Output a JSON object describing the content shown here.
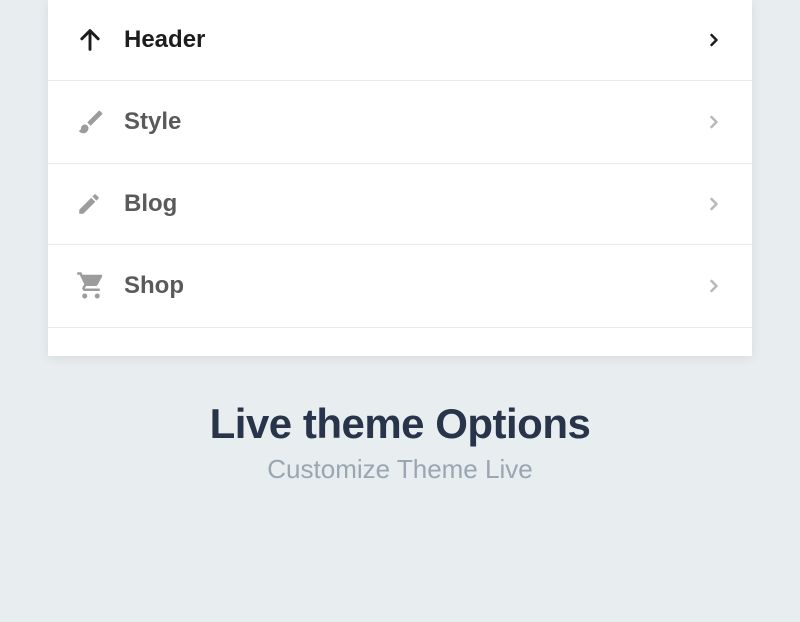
{
  "menu": {
    "items": [
      {
        "label": "Header",
        "icon": "arrow-up",
        "active": true
      },
      {
        "label": "Style",
        "icon": "brush",
        "active": false
      },
      {
        "label": "Blog",
        "icon": "pencil",
        "active": false
      },
      {
        "label": "Shop",
        "icon": "cart",
        "active": false
      }
    ]
  },
  "heading": {
    "title": "Live theme Options",
    "subtitle": "Customize Theme Live"
  },
  "colors": {
    "iconInactive": "#9c9c9c",
    "iconActive": "#1d1d1d",
    "chevronInactive": "#b8b8b8",
    "chevronActive": "#1d1d1d"
  }
}
